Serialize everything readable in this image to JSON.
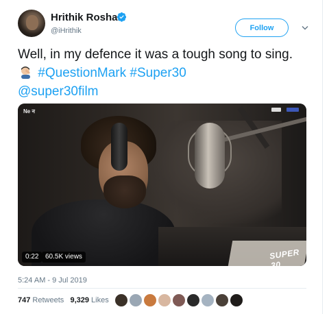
{
  "tweet": {
    "author_name": "Hrithik Roshan",
    "author_handle": "@iHrithik",
    "follow_label": "Follow",
    "text_prefix": "Well, in my defence it was a tough song to sing.",
    "emoji": "man-facepalming-emoji",
    "hashtag1": "#QuestionMark",
    "hashtag2": "#Super30",
    "mention": "@super30film",
    "timestamp": "5:24 AM - 9 Jul 2019"
  },
  "video": {
    "duration": "0:22",
    "views": "60.5K views",
    "watermark": "SUPER 30",
    "corner_badge": "Ne न"
  },
  "engagement": {
    "retweets_count": "747",
    "retweets_label": "Retweets",
    "likes_count": "9,329",
    "likes_label": "Likes"
  },
  "colors": {
    "accent": "#1da1f2",
    "text": "#14171a",
    "muted": "#657786"
  },
  "likers": [
    "liker-avatar-1",
    "liker-avatar-2",
    "liker-avatar-3",
    "liker-avatar-4",
    "liker-avatar-5",
    "liker-avatar-6",
    "liker-avatar-7",
    "liker-avatar-8",
    "liker-avatar-9"
  ]
}
